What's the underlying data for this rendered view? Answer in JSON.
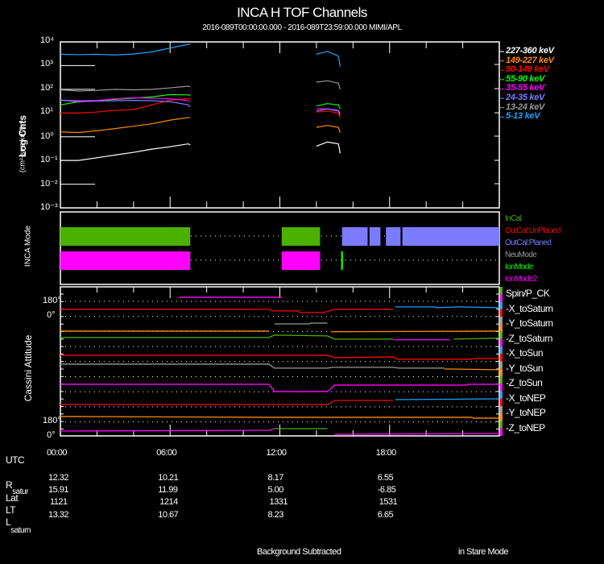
{
  "header": {
    "title": "INCA H TOF Channels",
    "subtitle": "2016-089T00:00:00.000 - 2016-089T23:59:00.000 MIMI/APL"
  },
  "chart_data": [
    {
      "type": "line",
      "title": "INCA H TOF Channels",
      "ylabel": "Log Cnts",
      "ylabel_units": "(cm²-sr-s-keV)⁻¹",
      "yscale": "log",
      "ylim": [
        0.001,
        10000
      ],
      "xlim_hours": [
        0,
        24
      ],
      "ytick_labels": [
        "10⁴",
        "10³",
        "10²",
        "10¹",
        "10⁰",
        "10⁻¹",
        "10⁻²",
        "10⁻³"
      ],
      "segments_hours": [
        [
          0,
          1,
          2,
          3,
          4,
          5,
          6,
          7,
          7.1
        ],
        [
          14.0,
          14.6,
          15.2,
          15.3
        ]
      ],
      "series": [
        {
          "name": "227-360 keV",
          "color": "#ffffff",
          "values": [
            [
              0.1,
              0.1,
              0.13,
              0.17,
              0.22,
              0.3,
              0.38,
              0.5,
              0.45
            ],
            [
              0.4,
              0.6,
              0.5,
              0.2
            ]
          ]
        },
        {
          "name": "149-227 keV",
          "color": "#ff8c00",
          "values": [
            [
              1.6,
              1.5,
              1.8,
              2.2,
              2.8,
              3.5,
              5,
              6.5,
              6.5
            ],
            [
              2.5,
              3,
              2.5,
              1.5
            ]
          ]
        },
        {
          "name": "90-149 keV",
          "color": "#ff0000",
          "values": [
            [
              10,
              10,
              11,
              13,
              14,
              22,
              35,
              40,
              40
            ],
            [
              11,
              12,
              10,
              6
            ]
          ]
        },
        {
          "name": "55-90 keV",
          "color": "#00ff00",
          "values": [
            [
              22,
              30,
              33,
              38,
              42,
              48,
              60,
              58,
              55
            ],
            [
              20,
              25,
              22,
              15
            ]
          ]
        },
        {
          "name": "35-55 keV",
          "color": "#ff00ff",
          "values": [
            [
              35,
              33,
              34,
              40,
              44,
              42,
              40,
              33,
              30
            ],
            [
              15,
              15,
              13,
              10
            ]
          ]
        },
        {
          "name": "24-35 keV",
          "color": "#7b7bff",
          "values": [
            [
              35,
              30,
              32,
              33,
              34,
              33,
              30,
              22,
              18
            ],
            [
              12,
              15,
              12,
              8
            ]
          ]
        },
        {
          "name": "13-24 keV",
          "color": "#999999",
          "values": [
            [
              95,
              85,
              90,
              100,
              95,
              100,
              115,
              135,
              130
            ],
            [
              200,
              230,
              180,
              100
            ]
          ]
        },
        {
          "name": "5-13 keV",
          "color": "#1ea0ff",
          "values": [
            [
              3000,
              2900,
              3000,
              2800,
              3100,
              3800,
              5500,
              8000,
              7800
            ],
            [
              3000,
              4000,
              2500,
              900
            ]
          ]
        }
      ]
    },
    {
      "type": "timeline",
      "ylabel": "INCA Mode",
      "legend": [
        {
          "name": "InCal",
          "color": "#4cb000"
        },
        {
          "name": "OutCal:UnPlaned",
          "color": "#ff0000"
        },
        {
          "name": "OutCal:Planed",
          "color": "#7b7bff"
        },
        {
          "name": "NeuMode",
          "color": "#999999"
        },
        {
          "name": "IonMode",
          "color": "#00ff00"
        },
        {
          "name": "IonMode2",
          "color": "#ff00ff"
        }
      ],
      "bars": [
        {
          "mode": "InCal",
          "lane": "upper",
          "color": "#4cb000",
          "start_h": 0,
          "end_h": 7.1
        },
        {
          "mode": "InCal",
          "lane": "upper",
          "color": "#4cb000",
          "start_h": 12.1,
          "end_h": 14.2
        },
        {
          "mode": "OutCal:Planed",
          "lane": "upper",
          "color": "#7b7bff",
          "start_h": 15.4,
          "end_h": 16.8
        },
        {
          "mode": "OutCal:Planed",
          "lane": "upper",
          "color": "#7b7bff",
          "start_h": 16.9,
          "end_h": 17.5
        },
        {
          "mode": "OutCal:Planed",
          "lane": "upper",
          "color": "#7b7bff",
          "start_h": 17.8,
          "end_h": 18.6
        },
        {
          "mode": "OutCal:Planed",
          "lane": "upper",
          "color": "#7b7bff",
          "start_h": 18.7,
          "end_h": 24
        },
        {
          "mode": "IonMode2",
          "lane": "lower",
          "color": "#ff00ff",
          "start_h": 0,
          "end_h": 7.1
        },
        {
          "mode": "IonMode2",
          "lane": "lower",
          "color": "#ff00ff",
          "start_h": 12.1,
          "end_h": 14.2
        },
        {
          "mode": "IonMode",
          "lane": "lower",
          "color": "#00ff00",
          "start_h": 15.35,
          "end_h": 15.45
        }
      ]
    },
    {
      "type": "line",
      "ylabel": "Cassini Attitude",
      "ytick_labels": [
        "180°",
        "0°",
        "180°",
        "0°"
      ],
      "units": "stacked degrees",
      "legend": [
        "Spin/P_CK",
        "-X_toSaturn",
        "-Y_toSaturn",
        "-Z_toSaturn",
        "-X_toSun",
        "-Y_toSun",
        "-Z_toSun",
        "-X_toNEP",
        "-Y_toNEP",
        "-Z_toNEP"
      ],
      "legend_stripe_colors": [
        "#4cb000",
        "#ff00ff",
        "#1ea0ff",
        "#ff0000",
        "#999999",
        "#ff8c00",
        "#4cb000",
        "#ff00ff",
        "#1ea0ff",
        "#ff0000",
        "#999999",
        "#ff8c00",
        "#4cb000",
        "#ff00ff",
        "#1ea0ff",
        "#ff0000",
        "#999999",
        "#ff8c00",
        "#4cb000",
        "#ff00ff"
      ],
      "traces": [
        {
          "segments": [
            {
              "color": "#ff00ff",
              "pts": [
                [
                  6.5,
                  1209
                ],
                [
                  12.1,
                  1209
                ]
              ]
            }
          ]
        },
        {
          "segments": [
            {
              "color": "#ff0000",
              "pts": [
                [
                  0,
                  1104
                ],
                [
                  11.4,
                  1104
                ],
                [
                  11.6,
                  1090
                ],
                [
                  13,
                  1090
                ],
                [
                  13.1,
                  1076
                ],
                [
                  14.4,
                  1076
                ],
                [
                  15,
                  1104
                ],
                [
                  18.2,
                  1104
                ]
              ]
            },
            {
              "color": "#1ea0ff",
              "pts": [
                [
                  18.3,
                  1125
                ],
                [
                  20.5,
                  1125
                ],
                [
                  20.6,
                  1118
                ],
                [
                  21.8,
                  1125
                ],
                [
                  24,
                  1118
                ]
              ]
            }
          ]
        },
        {
          "segments": [
            {
              "color": "#ff8c00",
              "pts": [
                [
                  0,
                  914
                ],
                [
                  11.4,
                  914
                ]
              ]
            },
            {
              "color": "#999999",
              "pts": [
                [
                  11.7,
                  977
                ],
                [
                  13.6,
                  977
                ],
                [
                  13.7,
                  984
                ],
                [
                  14.6,
                  984
                ]
              ]
            },
            {
              "color": "#ff8c00",
              "pts": [
                [
                  14.8,
                  908
                ],
                [
                  24,
                  914
                ]
              ]
            }
          ]
        },
        {
          "segments": [
            {
              "color": "#4cb000",
              "pts": [
                [
                  0,
                  858
                ],
                [
                  11.4,
                  858
                ],
                [
                  11.7,
                  879
                ],
                [
                  14.6,
                  872
                ],
                [
                  15,
                  844
                ],
                [
                  18.2,
                  844
                ]
              ]
            },
            {
              "color": "#ff00ff",
              "pts": [
                [
                  18.2,
                  838
                ],
                [
                  21.3,
                  838
                ]
              ]
            },
            {
              "color": "#4cb000",
              "pts": [
                [
                  21.5,
                  844
                ],
                [
                  24,
                  852
                ]
              ]
            }
          ]
        },
        {
          "segments": [
            {
              "color": "#ff0000",
              "pts": [
                [
                  0,
                  703
                ],
                [
                  14.6,
                  703
                ],
                [
                  15,
                  682
                ],
                [
                  18.2,
                  689
                ],
                [
                  18.4,
                  669
                ],
                [
                  22.5,
                  669
                ],
                [
                  22.6,
                  675
                ],
                [
                  24,
                  675
                ]
              ]
            }
          ]
        },
        {
          "segments": [
            {
              "color": "#999999",
              "pts": [
                [
                  0,
                  626
                ],
                [
                  11.4,
                  626
                ],
                [
                  11.7,
                  591
                ],
                [
                  14.6,
                  591
                ],
                [
                  14.9,
                  598
                ],
                [
                  18.2,
                  598
                ],
                [
                  18.5,
                  591
                ],
                [
                  21,
                  591
                ]
              ]
            },
            {
              "color": "#ff8c00",
              "pts": [
                [
                  21,
                  584
                ],
                [
                  24,
                  577
                ]
              ]
            }
          ]
        },
        {
          "segments": [
            {
              "color": "#ff00ff",
              "pts": [
                [
                  0,
                  450
                ],
                [
                  11.4,
                  450
                ],
                [
                  11.7,
                  387
                ],
                [
                  14.6,
                  387
                ],
                [
                  15,
                  443
                ],
                [
                  22.2,
                  443
                ],
                [
                  22.3,
                  450
                ],
                [
                  24,
                  450
                ]
              ]
            }
          ]
        },
        {
          "segments": [
            {
              "color": "#ff0000",
              "pts": [
                [
                  0,
                  274
                ],
                [
                  14.6,
                  274
                ],
                [
                  15,
                  309
                ],
                [
                  18.2,
                  309
                ]
              ]
            },
            {
              "color": "#1ea0ff",
              "pts": [
                [
                  18.3,
                  316
                ],
                [
                  24,
                  323
                ]
              ]
            }
          ]
        },
        {
          "segments": [
            {
              "color": "#ff8c00",
              "pts": [
                [
                  0,
                  169
                ],
                [
                  11.4,
                  162
                ],
                [
                  22.5,
                  162
                ],
                [
                  22.6,
                  155
                ],
                [
                  24,
                  155
                ]
              ]
            }
          ]
        },
        {
          "segments": [
            {
              "color": "#ff00ff",
              "pts": [
                [
                  0,
                  42
                ],
                [
                  11.4,
                  49
                ],
                [
                  11.7,
                  63
                ]
              ]
            },
            {
              "color": "#4cb000",
              "pts": [
                [
                  11.7,
                  63
                ],
                [
                  14.6,
                  63
                ]
              ]
            },
            {
              "color": "#ff00ff",
              "pts": [
                [
                  15,
                  14
                ],
                [
                  24,
                  21
                ]
              ]
            }
          ]
        }
      ]
    }
  ],
  "ephemeris": {
    "row_labels": {
      "utc": "UTC",
      "r": "R",
      "r_sub": "satur",
      "lat": "Lat",
      "lt": "LT",
      "l": "L",
      "l_sub": "saturn"
    },
    "columns": [
      {
        "utc": "00:00",
        "r": "12.32",
        "lat": "15.91",
        "lt": "1121",
        "l": "13.32",
        "hour": 0
      },
      {
        "utc": "06:00",
        "r": "10.21",
        "lat": "11.99",
        "lt": "1214",
        "l": "10.67",
        "hour": 6
      },
      {
        "utc": "12:00",
        "r": "8.17",
        "lat": "5.00",
        "lt": "1331",
        "l": "8.23",
        "hour": 12
      },
      {
        "utc": "18:00",
        "r": "6.55",
        "lat": "-6.85",
        "lt": "1531",
        "l": "6.65",
        "hour": 18
      }
    ]
  },
  "footer": {
    "left": "Background Subtracted",
    "right": "in Stare Mode"
  }
}
